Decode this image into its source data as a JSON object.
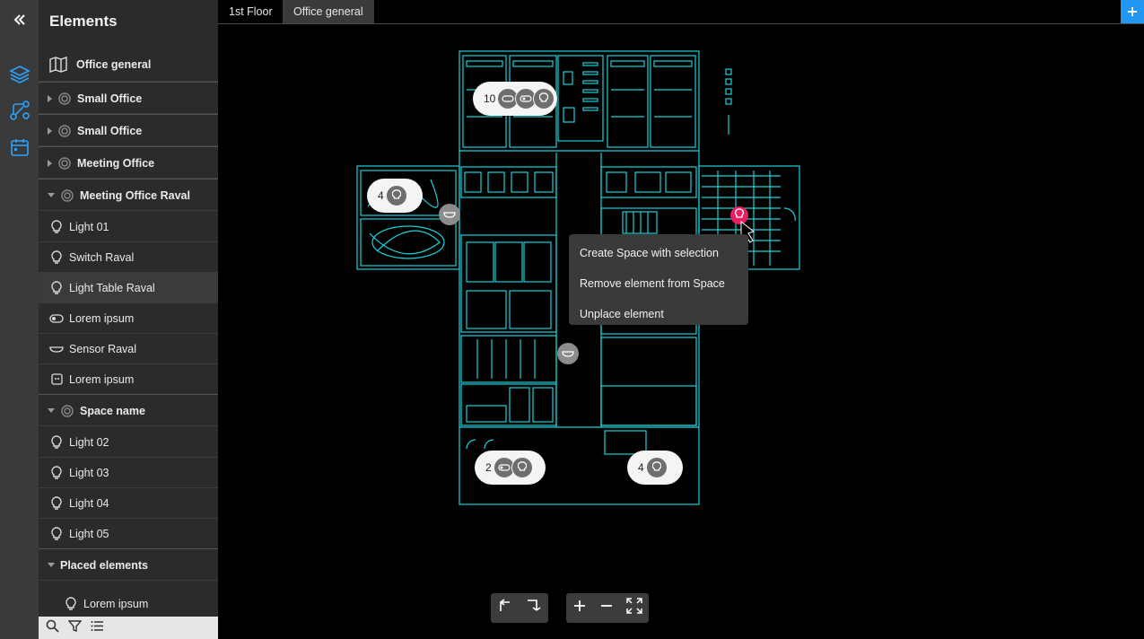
{
  "tabs": [
    {
      "label": "1st Floor"
    },
    {
      "label": "Office general"
    }
  ],
  "panel": {
    "title": "Elements",
    "map_item": "Office general",
    "groups": [
      {
        "label": "Small Office"
      },
      {
        "label": "Small Office"
      },
      {
        "label": "Meeting Office"
      },
      {
        "label": "Meeting Office Raval"
      }
    ],
    "raval_items": [
      {
        "label": "Light 01",
        "icon": "bulb-icon"
      },
      {
        "label": "Switch Raval",
        "icon": "bulb-icon"
      },
      {
        "label": "Light Table Raval",
        "icon": "bulb-icon"
      },
      {
        "label": "Lorem ipsum",
        "icon": "toggle-icon"
      },
      {
        "label": "Sensor Raval",
        "icon": "sensor-icon"
      },
      {
        "label": "Lorem ipsum",
        "icon": "device-icon"
      }
    ],
    "space": {
      "label": "Space name"
    },
    "space_items": [
      {
        "label": "Light 02"
      },
      {
        "label": "Light 03"
      },
      {
        "label": "Light 04"
      },
      {
        "label": "Light 05"
      }
    ],
    "placed": {
      "label": "Placed elements"
    },
    "placed_items": [
      {
        "label": "Lorem ipsum"
      }
    ]
  },
  "map": {
    "clusters": [
      {
        "count": "10"
      },
      {
        "count": "4"
      },
      {
        "count": "2"
      },
      {
        "count": "4"
      }
    ],
    "context_menu": [
      {
        "label": "Create Space with selection"
      },
      {
        "label": "Remove element from Space"
      },
      {
        "label": "Unplace element"
      }
    ]
  },
  "colors": {
    "accent": "#2196f3",
    "floorplan": "#19d3da",
    "marker": "#e91e63"
  }
}
